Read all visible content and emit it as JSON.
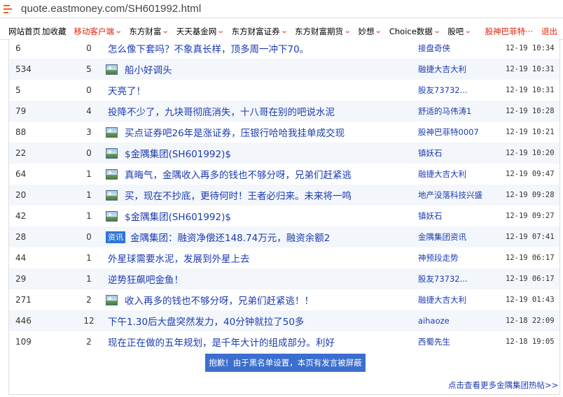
{
  "browser": {
    "url": "quote.eastmoney.com/SH601992.html"
  },
  "nav": {
    "items": [
      {
        "label": "网站首页",
        "red": false,
        "caret": false
      },
      {
        "label": "加收藏",
        "red": false,
        "caret": false
      },
      {
        "label": "移动客户端",
        "red": true,
        "caret": true
      },
      {
        "label": "东方财富",
        "red": false,
        "caret": true
      },
      {
        "label": "天天基金网",
        "red": false,
        "caret": true
      },
      {
        "label": "东方财富证券",
        "red": false,
        "caret": true
      },
      {
        "label": "东方财富期货",
        "red": false,
        "caret": true
      },
      {
        "label": "妙想",
        "red": false,
        "caret": true
      },
      {
        "label": "Choice数据",
        "red": false,
        "caret": true
      },
      {
        "label": "股吧",
        "red": false,
        "caret": true
      }
    ],
    "user": "股神巴菲特···",
    "logout": "退出"
  },
  "posts": [
    {
      "reads": "6",
      "replies": "0",
      "icon": "",
      "title": "怎么像下套吗？不象真长样，顶多周一冲下70。",
      "author": "接盘奇侠",
      "time": "12-19 10:34"
    },
    {
      "reads": "534",
      "replies": "5",
      "icon": "image-icon",
      "title": "船小好调头",
      "author": "融捷大吉大利",
      "time": "12-19 10:31"
    },
    {
      "reads": "5",
      "replies": "0",
      "icon": "",
      "title": "天亮了！",
      "author": "股友73732...",
      "time": "12-19 10:31"
    },
    {
      "reads": "79",
      "replies": "4",
      "icon": "",
      "title": "投降不少了，九块哥彻底消失，十八哥在别的吧说水泥",
      "author": "舒适的马伟涛1",
      "time": "12-19 10:28"
    },
    {
      "reads": "88",
      "replies": "3",
      "icon": "image-icon",
      "title": "买点证券吧26年是涨证券，压银行哈哈我挂单成交现",
      "author": "股神巴菲特0007",
      "time": "12-19 10:21"
    },
    {
      "reads": "22",
      "replies": "0",
      "icon": "image-icon",
      "title": "$金隅集团(SH601992)$",
      "author": "镇妖石",
      "time": "12-19 10:20"
    },
    {
      "reads": "64",
      "replies": "1",
      "icon": "image-icon",
      "title": "真晦气，金隅收入再多的钱也不够分呀，兄弟们赶紧逃",
      "author": "融捷大吉大利",
      "time": "12-19 09:47"
    },
    {
      "reads": "20",
      "replies": "1",
      "icon": "image-icon",
      "title": "买，现在不抄底，更待何时！王者必归来。未来将一鸣",
      "author": "地产没落科技兴盛",
      "time": "12-19 09:28"
    },
    {
      "reads": "42",
      "replies": "1",
      "icon": "image-icon",
      "title": "$金隅集团(SH601992)$",
      "author": "镇妖石",
      "time": "12-19 09:27"
    },
    {
      "reads": "28",
      "replies": "0",
      "icon": "news-badge",
      "title": "金隅集团：融资净偿还148.74万元，融资余额2",
      "author": "金隅集团资讯",
      "time": "12-19 07:41"
    },
    {
      "reads": "44",
      "replies": "1",
      "icon": "",
      "title": "外星球需要水泥，发展到外星上去",
      "author": "神预段走势",
      "time": "12-19 06:17"
    },
    {
      "reads": "29",
      "replies": "1",
      "icon": "",
      "title": "逆势狂飙吧金鱼！",
      "author": "股友73732...",
      "time": "12-19 06:17"
    },
    {
      "reads": "271",
      "replies": "2",
      "icon": "image-icon",
      "title": "收入再多的钱也不够分呀，兄弟们赶紧逃！！",
      "author": "融捷大吉大利",
      "time": "12-19 01:43"
    },
    {
      "reads": "446",
      "replies": "12",
      "icon": "",
      "title": "下午1.30后大盘突然发力，40分钟就拉了50多",
      "author": "aihaoze",
      "time": "12-18 22:09"
    },
    {
      "reads": "109",
      "replies": "2",
      "icon": "",
      "title": "现在正在做的五年规划，是千年大计的组成部分。利好",
      "author": "西蜀先生",
      "time": "12-18 19:05"
    }
  ],
  "news_badge_label": "资讯",
  "block_notice": "抱歉！由于黑名单设置，本页有发言被屏蔽",
  "more_link": "点击查看更多金隅集团热帖>>",
  "colors": {
    "link": "#1a3bb0",
    "accent_red": "#e0220a",
    "badge_blue": "#2d75d8",
    "notice_blue": "#3b6fcf"
  }
}
